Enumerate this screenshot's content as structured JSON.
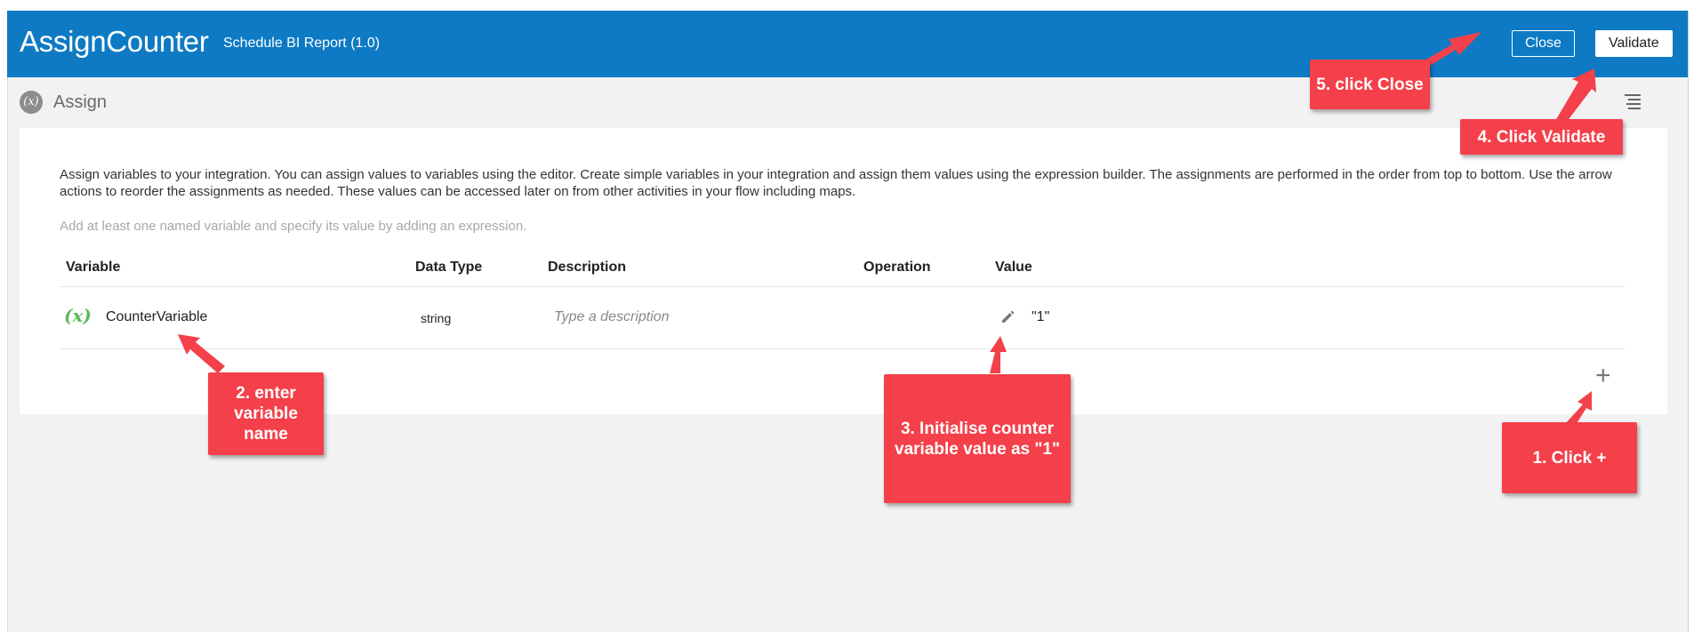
{
  "header": {
    "title": "AssignCounter",
    "subtitle": "Schedule BI Report (1.0)",
    "close_label": "Close",
    "validate_label": "Validate"
  },
  "subbar": {
    "icon_glyph": "(x)",
    "title": "Assign"
  },
  "panel": {
    "description": "Assign variables to your integration. You can assign values to variables using the editor. Create simple variables in your integration and assign them values using the expression builder. The assignments are performed in the order from top to bottom. Use the arrow actions to reorder the assignments as needed. These values can be accessed later on from other activities in your flow including maps.",
    "hint": "Add at least one named variable and specify its value by adding an expression."
  },
  "table": {
    "columns": [
      "Variable",
      "Data Type",
      "Description",
      "Operation",
      "Value"
    ],
    "rows": [
      {
        "icon_glyph": "(x)",
        "variable": "CounterVariable",
        "data_type": "string",
        "description_placeholder": "Type a description",
        "value": "\"1\""
      }
    ],
    "add_glyph": "+"
  },
  "callouts": {
    "c1": "1. Click +",
    "c2": "2. enter variable name",
    "c3": "3. Initialise counter variable value as \"1\"",
    "c4": "4. Click Validate",
    "c5": "5. click Close"
  },
  "colors": {
    "header_bg": "#0e7ac4",
    "callout_bg": "#f4404a",
    "variable_icon": "#5cb85c"
  }
}
